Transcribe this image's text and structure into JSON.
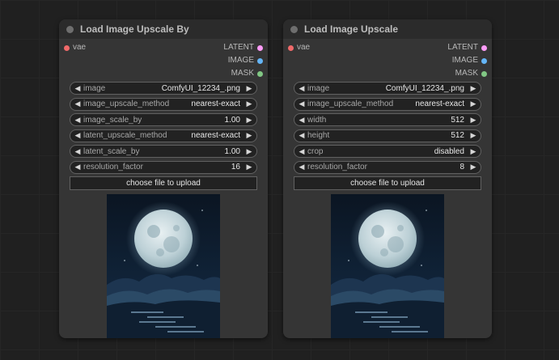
{
  "nodes": [
    {
      "title": "Load Image Upscale By",
      "input": {
        "label": "vae",
        "color": "#f06a6a"
      },
      "outputs": [
        {
          "label": "LATENT",
          "color": "#ff9cf9"
        },
        {
          "label": "IMAGE",
          "color": "#64b5f6"
        },
        {
          "label": "MASK",
          "color": "#81c784"
        }
      ],
      "widgets": [
        {
          "label": "image",
          "value": "ComfyUI_12234_.png"
        },
        {
          "label": "image_upscale_method",
          "value": "nearest-exact"
        },
        {
          "label": "image_scale_by",
          "value": "1.00"
        },
        {
          "label": "latent_upscale_method",
          "value": "nearest-exact"
        },
        {
          "label": "latent_scale_by",
          "value": "1.00"
        },
        {
          "label": "resolution_factor",
          "value": "16"
        }
      ],
      "upload_label": "choose file to upload"
    },
    {
      "title": "Load Image Upscale",
      "input": {
        "label": "vae",
        "color": "#f06a6a"
      },
      "outputs": [
        {
          "label": "LATENT",
          "color": "#ff9cf9"
        },
        {
          "label": "IMAGE",
          "color": "#64b5f6"
        },
        {
          "label": "MASK",
          "color": "#81c784"
        }
      ],
      "widgets": [
        {
          "label": "image",
          "value": "ComfyUI_12234_.png"
        },
        {
          "label": "image_upscale_method",
          "value": "nearest-exact"
        },
        {
          "label": "width",
          "value": "512"
        },
        {
          "label": "height",
          "value": "512"
        },
        {
          "label": "crop",
          "value": "disabled"
        },
        {
          "label": "resolution_factor",
          "value": "8"
        }
      ],
      "upload_label": "choose file to upload"
    }
  ],
  "icons": {
    "left_arrow": "◀",
    "right_arrow": "▶"
  }
}
